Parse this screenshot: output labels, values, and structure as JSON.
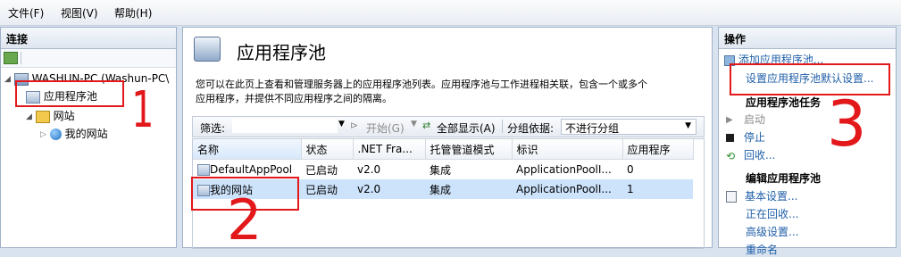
{
  "menu": {
    "file": "文件(F)",
    "view": "视图(V)",
    "help": "帮助(H)"
  },
  "left_pane": {
    "title": "连接",
    "server": "WASHUN-PC (Washun-PC\\",
    "app_pools": "应用程序池",
    "sites": "网站",
    "my_site": "我的网站"
  },
  "main": {
    "title": "应用程序池",
    "description_line1": "您可以在此页上查看和管理服务器上的应用程序池列表。应用程序池与工作进程相关联，包含一个或多个",
    "description_line2": "应用程序，并提供不同应用程序之间的隔离。",
    "toolbar": {
      "filter_label": "筛选:",
      "start_label": "开始(G)",
      "show_all_label": "全部显示(A)",
      "group_by_label": "分组依据:",
      "group_by_value": "不进行分组"
    },
    "columns": [
      "名称",
      "状态",
      ".NET Fra...",
      "托管管道模式",
      "标识",
      "应用程序"
    ],
    "rows": [
      [
        "DefaultAppPool",
        "已启动",
        "v2.0",
        "集成",
        "ApplicationPoolI...",
        "0"
      ],
      [
        "我的网站",
        "已启动",
        "v2.0",
        "集成",
        "ApplicationPoolI...",
        "1"
      ]
    ]
  },
  "actions": {
    "title": "操作",
    "add_pool": "添加应用程序池...",
    "set_defaults": "设置应用程序池默认设置...",
    "tasks_heading": "应用程序池任务",
    "start": "启动",
    "stop": "停止",
    "recycle": "回收...",
    "edit_heading": "编辑应用程序池",
    "basic_settings": "基本设置...",
    "recycling": "正在回收...",
    "advanced_settings": "高级设置...",
    "rename": "重命名"
  },
  "annotations": {
    "one": "1",
    "two": "2",
    "three": "3"
  },
  "colors": {
    "annotation": "#e2181b",
    "link": "#1f5fa8",
    "selection": "#cde3fb"
  }
}
